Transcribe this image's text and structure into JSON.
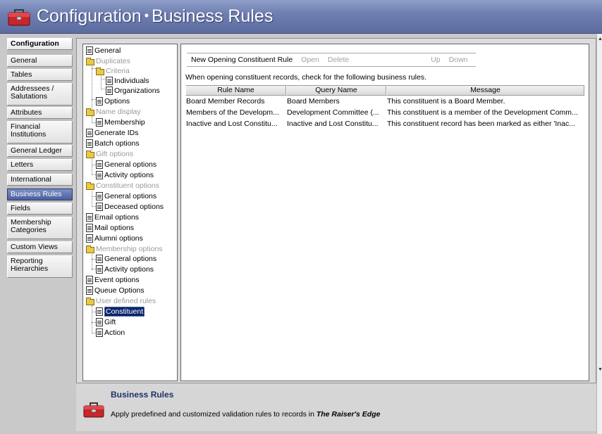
{
  "window": {
    "title_section": "Configuration",
    "title_separator": "•",
    "title_page": "Business Rules",
    "icon": "toolbox-icon"
  },
  "nav": {
    "items": [
      {
        "label": "Configuration",
        "header": true
      },
      {
        "label": "General"
      },
      {
        "label": "Tables"
      },
      {
        "label": "Addressees / Salutations"
      },
      {
        "label": "Attributes"
      },
      {
        "label": "Financial Institutions"
      },
      {
        "label": "General Ledger"
      },
      {
        "label": "Letters"
      },
      {
        "label": "International"
      },
      {
        "label": "Business Rules",
        "selected": true
      },
      {
        "label": "Fields"
      },
      {
        "label": "Membership Categories"
      },
      {
        "label": "Custom Views"
      },
      {
        "label": "Reporting Hierarchies"
      }
    ]
  },
  "tree": {
    "items": [
      {
        "label": "General",
        "type": "doc"
      },
      {
        "label": "Duplicates",
        "type": "folder",
        "muted": true
      },
      {
        "label": "Criteria",
        "type": "folder",
        "muted": true
      },
      {
        "label": "Individuals",
        "type": "doc"
      },
      {
        "label": "Organizations",
        "type": "doc"
      },
      {
        "label": "Options",
        "type": "doc"
      },
      {
        "label": "Name display",
        "type": "folder",
        "muted": true
      },
      {
        "label": "Membership",
        "type": "doc"
      },
      {
        "label": "Generate IDs",
        "type": "doc"
      },
      {
        "label": "Batch options",
        "type": "doc"
      },
      {
        "label": "Gift options",
        "type": "folder",
        "muted": true
      },
      {
        "label": "General options",
        "type": "doc"
      },
      {
        "label": "Activity options",
        "type": "doc"
      },
      {
        "label": "Constituent options",
        "type": "folder",
        "muted": true
      },
      {
        "label": "General options",
        "type": "doc"
      },
      {
        "label": "Deceased options",
        "type": "doc"
      },
      {
        "label": "Email options",
        "type": "doc"
      },
      {
        "label": "Mail options",
        "type": "doc"
      },
      {
        "label": "Alumni options",
        "type": "doc"
      },
      {
        "label": "Membership options",
        "type": "folder",
        "muted": true
      },
      {
        "label": "General options",
        "type": "doc"
      },
      {
        "label": "Activity options",
        "type": "doc"
      },
      {
        "label": "Event options",
        "type": "doc"
      },
      {
        "label": "Queue Options",
        "type": "doc"
      },
      {
        "label": "User defined rules",
        "type": "folder",
        "muted": true
      },
      {
        "label": "Constituent",
        "type": "doc",
        "selected": true
      },
      {
        "label": "Gift",
        "type": "doc"
      },
      {
        "label": "Action",
        "type": "doc"
      }
    ]
  },
  "toolbar": {
    "new_label": "New Opening Constituent Rule",
    "open_label": "Open",
    "delete_label": "Delete",
    "up_label": "Up",
    "down_label": "Down"
  },
  "main": {
    "instructions": "When opening constituent records, check for the following business rules."
  },
  "grid": {
    "columns": [
      "Rule Name",
      "Query Name",
      "Message"
    ],
    "rows": [
      [
        "Board Member Records",
        "Board Members",
        "This constituent is a Board Member."
      ],
      [
        "Members of the Developm...",
        "Development Committee (...",
        "This constituent is a member of the Development Comm..."
      ],
      [
        "Inactive and Lost Constitu...",
        "Inactive and Lost Constitu...",
        "This constituent record has been marked as either 'Inac..."
      ]
    ]
  },
  "description": {
    "title": "Business Rules",
    "text_prefix": "Apply predefined and customized validation rules to records in ",
    "text_product": "The Raiser's Edge"
  },
  "colors": {
    "titlebar": "#6f7fb0",
    "nav_selected": "#4b5e9c",
    "tree_selected": "#0a246a",
    "desc_title": "#20306a"
  }
}
